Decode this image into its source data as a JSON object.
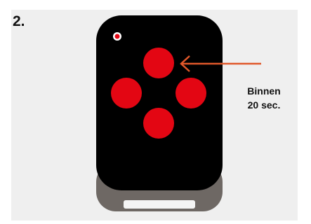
{
  "step": {
    "number": "2."
  },
  "note": {
    "line1": "Binnen",
    "line2": "20 sec."
  },
  "icons": {
    "led": "led-indicator-icon",
    "arrow": "arrow-left-icon"
  },
  "colors": {
    "remote_body": "#000000",
    "remote_base": "#6e6864",
    "buttons": "#e30613",
    "arrow": "#e0582a",
    "panel": "#efefef"
  }
}
